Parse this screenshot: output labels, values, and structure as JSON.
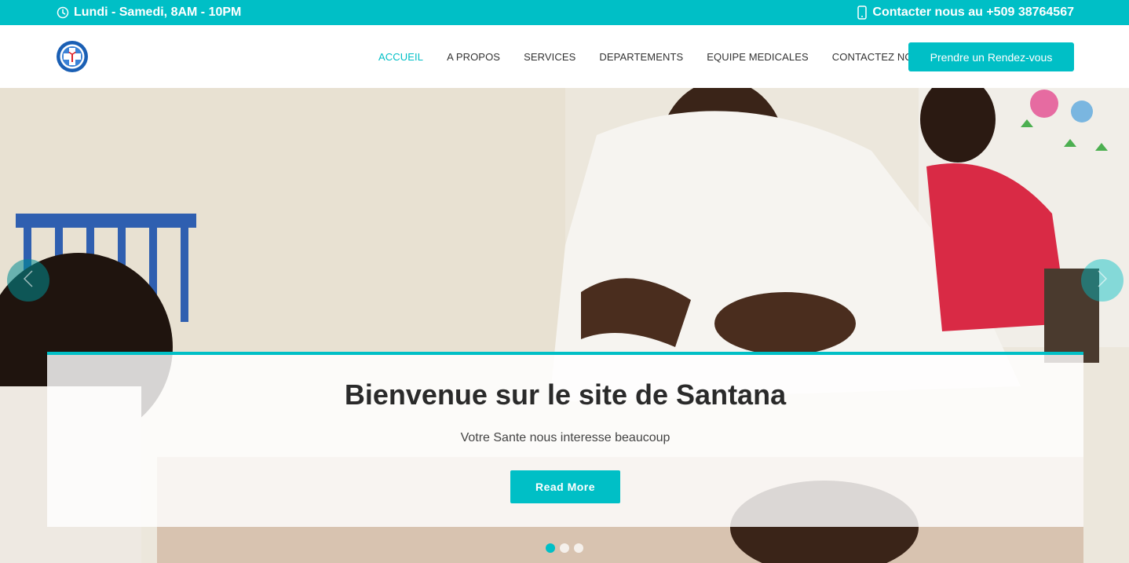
{
  "topbar": {
    "hours": "Lundi - Samedi, 8AM - 10PM",
    "contact": "Contacter nous au +509 38764567",
    "hours_icon": "clock-icon",
    "contact_icon": "mobile-phone-icon"
  },
  "header": {
    "logo_icon": "medical-cross-logo",
    "nav": [
      {
        "label": "ACCUEIL",
        "active": true
      },
      {
        "label": "A PROPOS",
        "active": false
      },
      {
        "label": "SERVICES",
        "active": false
      },
      {
        "label": "DEPARTEMENTS",
        "active": false
      },
      {
        "label": "EQUIPE MEDICALES",
        "active": false
      },
      {
        "label": "CONTACTEZ NOUS",
        "active": false
      }
    ],
    "cta_label": "Prendre un Rendez-vous"
  },
  "hero": {
    "title": "Bienvenue sur le site de Santana",
    "subtitle": "Votre Sante nous interesse beaucoup",
    "button_label": "Read More",
    "slide_count": 3,
    "active_slide": 1,
    "prev_icon": "chevron-left-icon",
    "next_icon": "chevron-right-icon"
  },
  "colors": {
    "accent": "#00bfc6",
    "text_dark": "#2a2a2a",
    "nav_text": "#333333"
  }
}
